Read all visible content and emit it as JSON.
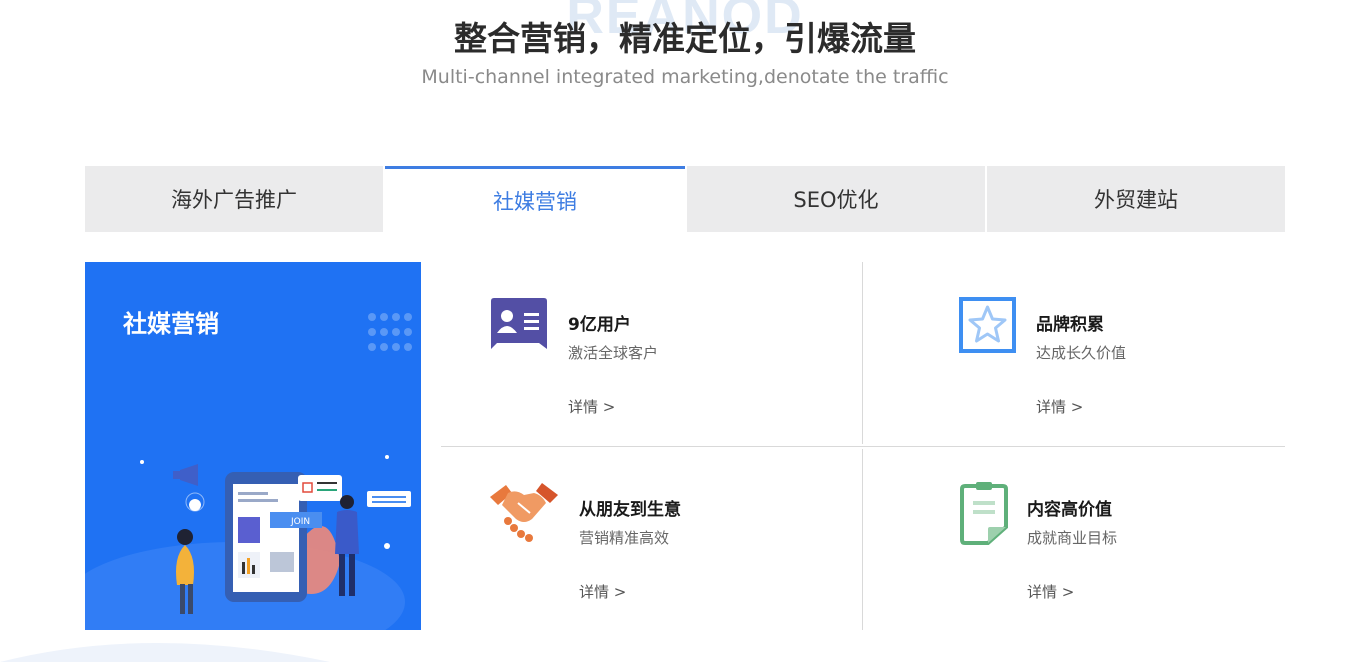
{
  "header": {
    "watermark": "REANOD",
    "title": "整合营销，精准定位，引爆流量",
    "subtitle": "Multi-channel integrated marketing,denotate the traffic"
  },
  "tabs": [
    {
      "label": "海外广告推广",
      "active": false
    },
    {
      "label": "社媒营销",
      "active": true
    },
    {
      "label": "SEO优化",
      "active": false
    },
    {
      "label": "外贸建站",
      "active": false
    }
  ],
  "hero": {
    "title": "社媒营销",
    "join_label": "JOIN"
  },
  "features": [
    {
      "title": "9亿用户",
      "desc": "激活全球客户",
      "link": "详情 >",
      "icon": "user-card-icon"
    },
    {
      "title": "品牌积累",
      "desc": "达成长久价值",
      "link": "详情 >",
      "icon": "star-icon"
    },
    {
      "title": "从朋友到生意",
      "desc": "营销精准高效",
      "link": "详情 >",
      "icon": "handshake-icon"
    },
    {
      "title": "内容高价值",
      "desc": "成就商业目标",
      "link": "详情 >",
      "icon": "clipboard-icon"
    }
  ],
  "colors": {
    "accent": "#3e7de2",
    "hero_bg": "#1f72f3",
    "tab_bg": "#ebebec"
  }
}
